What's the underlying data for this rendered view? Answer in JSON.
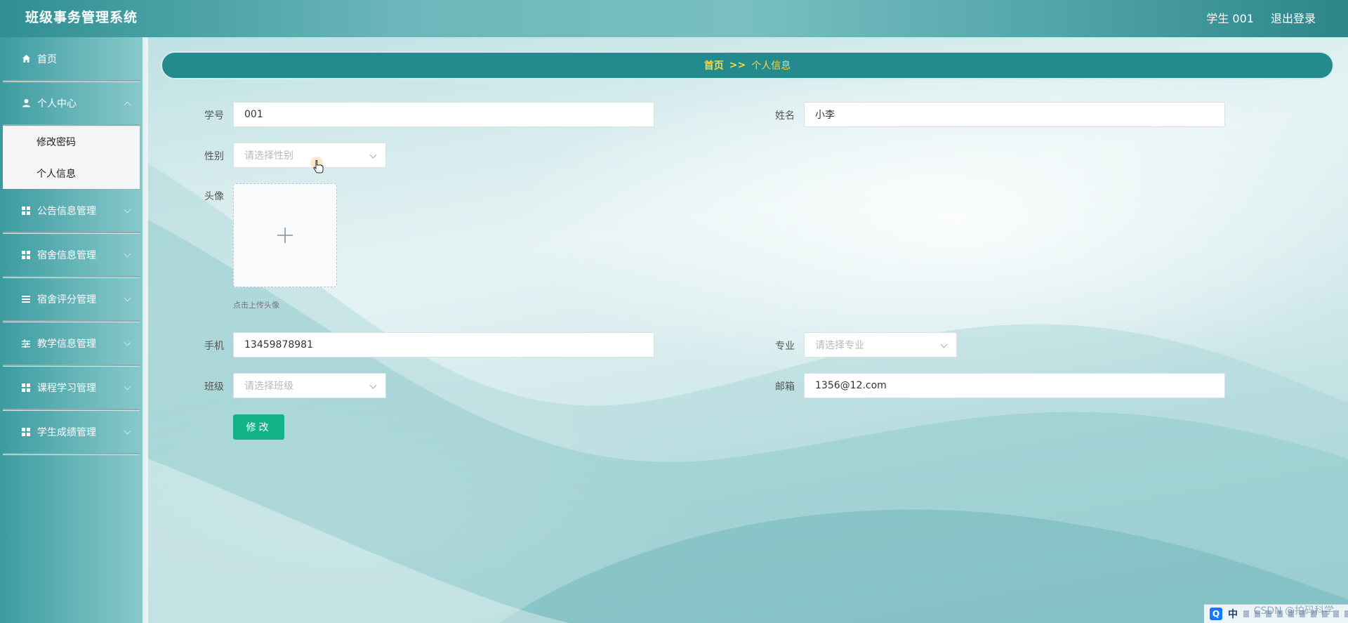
{
  "header": {
    "title": "班级事务管理系统",
    "user_label": "学生 001",
    "logout_label": "退出登录"
  },
  "sidebar": {
    "items": [
      {
        "label": "首页",
        "icon": "home-icon"
      },
      {
        "label": "个人中心",
        "icon": "user-icon",
        "submenu": [
          "修改密码",
          "个人信息"
        ]
      },
      {
        "label": "公告信息管理",
        "icon": "grid-icon"
      },
      {
        "label": "宿舍信息管理",
        "icon": "grid-icon"
      },
      {
        "label": "宿舍评分管理",
        "icon": "list-icon"
      },
      {
        "label": "教学信息管理",
        "icon": "sliders-icon"
      },
      {
        "label": "课程学习管理",
        "icon": "grid-icon"
      },
      {
        "label": "学生成绩管理",
        "icon": "grid-icon"
      }
    ]
  },
  "breadcrumb": {
    "home": "首页",
    "separator": ">>",
    "current": "个人信息"
  },
  "form": {
    "student_id": {
      "label": "学号",
      "value": "001"
    },
    "name": {
      "label": "姓名",
      "value": "小李"
    },
    "gender": {
      "label": "性别",
      "placeholder": "请选择性别"
    },
    "avatar": {
      "label": "头像",
      "hint": "点击上传头像"
    },
    "phone": {
      "label": "手机",
      "value": "13459878981"
    },
    "major": {
      "label": "专业",
      "placeholder": "请选择专业"
    },
    "class": {
      "label": "班级",
      "placeholder": "请选择班级"
    },
    "email": {
      "label": "邮箱",
      "value": "1356@12.com"
    },
    "submit_label": "修改"
  },
  "taskbar": {
    "ime_label": "中",
    "watermark": "CSDN @拍码科学"
  },
  "colors": {
    "accent": "#238a8e",
    "breadcrumb_text": "#f5d94a",
    "submit": "#13b38a"
  }
}
